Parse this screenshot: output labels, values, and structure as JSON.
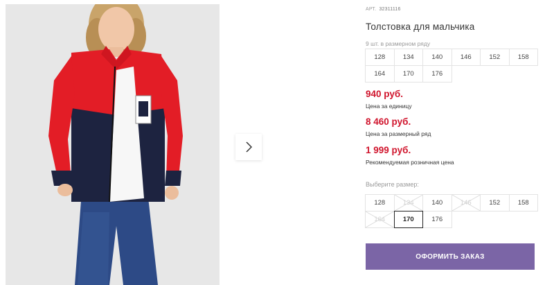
{
  "product": {
    "article_label": "АРТ.",
    "article_number": "32311116",
    "title": "Толстовка для мальчика",
    "range_note": "9 шт. в размерном ряду",
    "range_sizes": [
      "128",
      "134",
      "140",
      "146",
      "152",
      "158",
      "164",
      "170",
      "176"
    ]
  },
  "prices": {
    "unit_price": "940 руб.",
    "unit_label": "Цена за единицу",
    "range_price": "8 460 руб.",
    "range_label": "Цена за размерный ряд",
    "retail_price": "1 999 руб.",
    "retail_label": "Рекомендуемая розничная цена"
  },
  "size_select": {
    "label": "Выберите размер:",
    "options": [
      {
        "size": "128",
        "available": true
      },
      {
        "size": "134",
        "available": false
      },
      {
        "size": "140",
        "available": true
      },
      {
        "size": "146",
        "available": false
      },
      {
        "size": "152",
        "available": true
      },
      {
        "size": "158",
        "available": true
      },
      {
        "size": "164",
        "available": false
      },
      {
        "size": "170",
        "available": true,
        "selected": true
      },
      {
        "size": "176",
        "available": true
      }
    ]
  },
  "actions": {
    "order_label": "ОФОРМИТЬ ЗАКАЗ",
    "next_icon": "chevron-right-icon"
  },
  "colors": {
    "price_red": "#d0142c",
    "button_purple": "#7b65a6"
  }
}
